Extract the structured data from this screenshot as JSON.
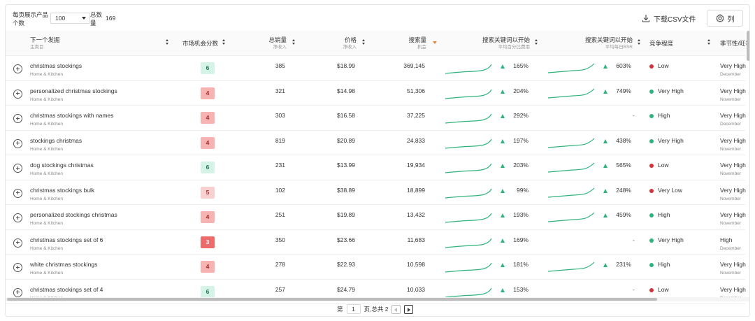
{
  "toolbar": {
    "per_page_label": "每页展示产品个数",
    "per_page_value": "100",
    "total_label": "总数量",
    "total_value": "169",
    "download_label": "下载CSV文件",
    "columns_label": "列"
  },
  "headers": {
    "keyword": "下一个发掘",
    "keyword_sub": "主类目",
    "score": "市场机会分数",
    "sales": "总销量",
    "sales_sub": "净收入",
    "price": "价格",
    "price_sub": "净收入",
    "search": "搜索量",
    "search_sub": "机会",
    "trend1": "搜索关键词以开始",
    "trend1_sub": "平均百分比费用",
    "trend2": "搜索关键词以开始",
    "trend2_sub": "平均每日BSR",
    "competition": "竞争程度",
    "seasonality": "季节性/旺季"
  },
  "rows": [
    {
      "keyword": "christmas stockings",
      "category": "Home & Kitchen",
      "score": "6",
      "sales": "385",
      "price": "$18.99",
      "search": "369,145",
      "t1": "165%",
      "t2": "603%",
      "competition": "Low",
      "comp_color": "#d6303a",
      "season": "Very High",
      "month": "December"
    },
    {
      "keyword": "personalized christmas stockings",
      "category": "Home & Kitchen",
      "score": "4",
      "sales": "321",
      "price": "$14.98",
      "search": "51,306",
      "t1": "204%",
      "t2": "749%",
      "competition": "Very High",
      "comp_color": "#2eb37c",
      "season": "Very High",
      "month": "November"
    },
    {
      "keyword": "christmas stockings with names",
      "category": "Home & Kitchen",
      "score": "4",
      "sales": "303",
      "price": "$16.58",
      "search": "37,225",
      "t1": "292%",
      "t2": "-",
      "competition": "High",
      "comp_color": "#2eb37c",
      "season": "Very High",
      "month": "December"
    },
    {
      "keyword": "stockings christmas",
      "category": "Home & Kitchen",
      "score": "4",
      "sales": "819",
      "price": "$20.89",
      "search": "24,833",
      "t1": "197%",
      "t2": "438%",
      "competition": "Very High",
      "comp_color": "#2eb37c",
      "season": "Very High",
      "month": "November"
    },
    {
      "keyword": "dog stockings christmas",
      "category": "Home & Kitchen",
      "score": "6",
      "sales": "231",
      "price": "$13.99",
      "search": "19,934",
      "t1": "203%",
      "t2": "565%",
      "competition": "Low",
      "comp_color": "#d6303a",
      "season": "Very High",
      "month": "November"
    },
    {
      "keyword": "christmas stockings bulk",
      "category": "Home & Kitchen",
      "score": "5",
      "sales": "102",
      "price": "$38.89",
      "search": "18,899",
      "t1": "99%",
      "t2": "248%",
      "competition": "Very Low",
      "comp_color": "#d6303a",
      "season": "Very High",
      "month": "November"
    },
    {
      "keyword": "personalized stockings christmas",
      "category": "Home & Kitchen",
      "score": "4",
      "sales": "251",
      "price": "$19.89",
      "search": "13,432",
      "t1": "193%",
      "t2": "459%",
      "competition": "High",
      "comp_color": "#2eb37c",
      "season": "Very High",
      "month": "November"
    },
    {
      "keyword": "christmas stockings set of 6",
      "category": "Home & Kitchen",
      "score": "3",
      "sales": "350",
      "price": "$23.66",
      "search": "11,683",
      "t1": "169%",
      "t2": "-",
      "competition": "Very High",
      "comp_color": "#2eb37c",
      "season": "High",
      "month": "December"
    },
    {
      "keyword": "white christmas stockings",
      "category": "Home & Kitchen",
      "score": "4",
      "sales": "278",
      "price": "$22.93",
      "search": "10,598",
      "t1": "181%",
      "t2": "231%",
      "competition": "High",
      "comp_color": "#2eb37c",
      "season": "Very High",
      "month": "November"
    },
    {
      "keyword": "christmas stockings set of 4",
      "category": "Home & Kitchen",
      "score": "6",
      "sales": "257",
      "price": "$24.79",
      "search": "10,033",
      "t1": "153%",
      "t2": "-",
      "competition": "Low",
      "comp_color": "#d6303a",
      "season": "Very High",
      "month": "December"
    }
  ],
  "pagination": {
    "page_prefix": "第",
    "page_value": "1",
    "page_suffix": "页,总共 2"
  }
}
